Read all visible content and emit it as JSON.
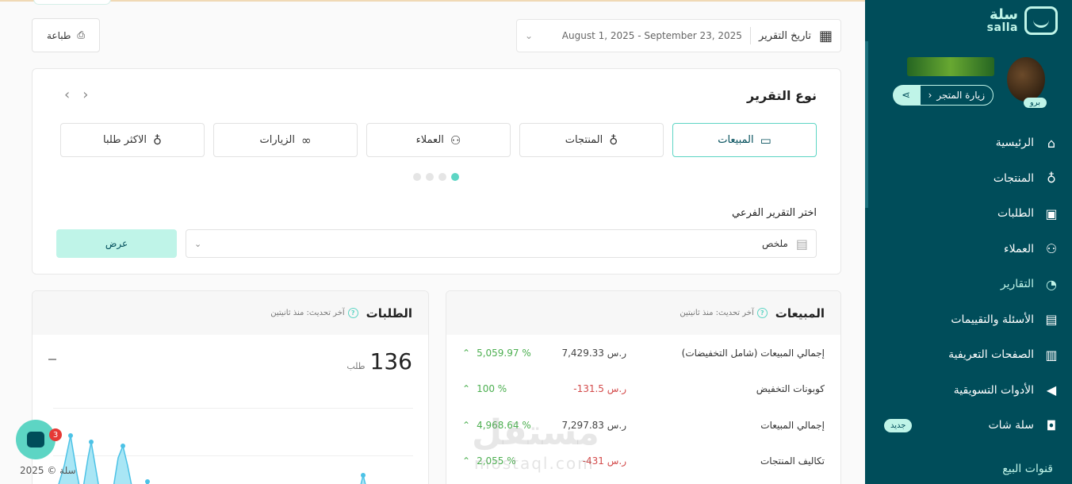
{
  "sidebar": {
    "logo_ar": "سلة",
    "logo_en": "salla",
    "badge": "برو",
    "visit_store": "زيارة المتجر",
    "items": [
      {
        "label": "الرئيسية",
        "icon": "home-icon"
      },
      {
        "label": "المنتجات",
        "icon": "shirt-icon"
      },
      {
        "label": "الطلبات",
        "icon": "box-icon"
      },
      {
        "label": "العملاء",
        "icon": "users-icon"
      },
      {
        "label": "التقارير",
        "icon": "pie-chart-icon"
      },
      {
        "label": "الأسئلة والتقييمات",
        "icon": "message-icon"
      },
      {
        "label": "الصفحات التعريفية",
        "icon": "newspaper-icon"
      },
      {
        "label": "الأدوات التسويقية",
        "icon": "megaphone-icon"
      },
      {
        "label": "سلة شات",
        "icon": "chat-icon"
      }
    ],
    "new_badge": "جديد",
    "sales_channels": "قنوات البيع"
  },
  "header": {
    "date_label": "تاريخ التقرير",
    "date_range": "August 1, 2025 - September 23, 2025",
    "print": "طباعة"
  },
  "report": {
    "title": "نوع التقرير",
    "tabs": [
      {
        "label": "المبيعات",
        "icon": "wallet-icon"
      },
      {
        "label": "المنتجات",
        "icon": "shirt-icon"
      },
      {
        "label": "العملاء",
        "icon": "users-icon"
      },
      {
        "label": "الزيارات",
        "icon": "link-icon"
      },
      {
        "label": "الاكثر طلبا",
        "icon": "shirt-icon"
      }
    ],
    "sub_label": "اختر التقرير الفرعي",
    "sub_value": "ملخص",
    "show": "عرض"
  },
  "sales": {
    "title": "المبيعات",
    "updated": "آخر تحديث: منذ ثانيتين",
    "rows": [
      {
        "label": "إجمالي المبيعات (شامل التخفيضات)",
        "value": "7,429.33 ر.س",
        "pct": "5,059.97 %"
      },
      {
        "label": "كوبونات التخفيض",
        "value": "-131.5 ر.س",
        "pct": "100 %"
      },
      {
        "label": "إجمالي المبيعات",
        "value": "7,297.83 ر.س",
        "pct": "4,968.64 %"
      },
      {
        "label": "تكاليف المنتجات",
        "value": "-431 ر.س",
        "pct": "2,055 %"
      }
    ]
  },
  "orders": {
    "title": "الطلبات",
    "updated": "آخر تحديث: منذ ثانيتين",
    "count": "136",
    "unit": "طلب"
  },
  "chat_count": "3",
  "copyright": "سلة © 2025",
  "watermark": "مستقل",
  "watermark_en": "mostaql.com"
}
